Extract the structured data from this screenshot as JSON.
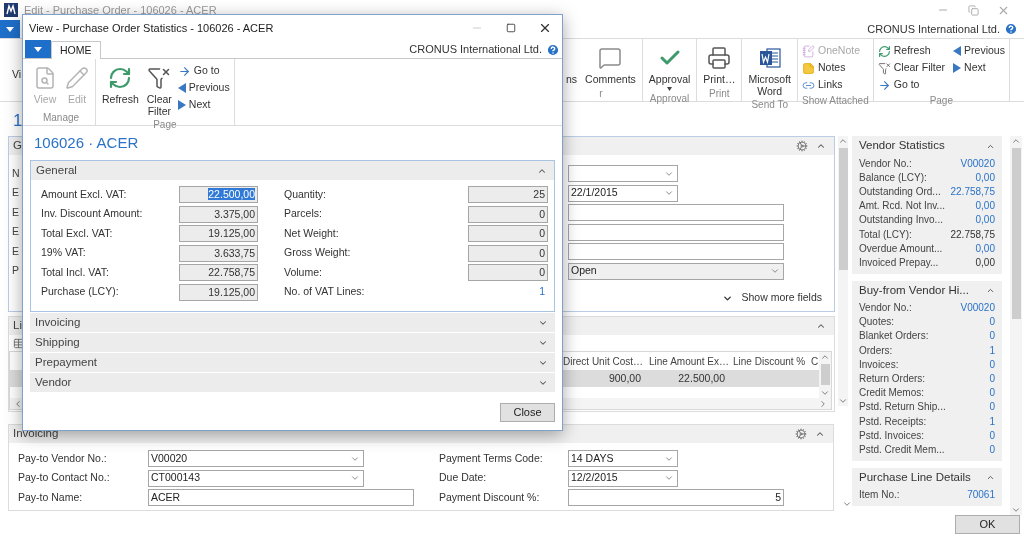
{
  "main_window": {
    "title": "Edit - Purchase Order - 106026 - ACER",
    "company": "CRONUS International Ltd.",
    "ribbon_fragment": "Vi",
    "ribbon_groups": [
      {
        "label": "r",
        "buttons": [
          {
            "kind": "large",
            "label": "ns",
            "disabled": false
          },
          {
            "kind": "large",
            "label": "Comments",
            "disabled": false
          }
        ]
      },
      {
        "label": "Approval",
        "buttons": [
          {
            "kind": "large",
            "label": "Approval",
            "dropdown": true,
            "disabled": false
          }
        ]
      },
      {
        "label": "Print",
        "buttons": [
          {
            "kind": "large",
            "label": "Print…",
            "disabled": false
          }
        ]
      },
      {
        "label": "Send To",
        "buttons": [
          {
            "kind": "large",
            "label": "Microsoft Word",
            "disabled": false
          }
        ]
      },
      {
        "label": "Show Attached",
        "buttons": [
          {
            "kind": "small",
            "label": "OneNote",
            "disabled": true
          },
          {
            "kind": "small",
            "label": "Notes",
            "disabled": false
          },
          {
            "kind": "small",
            "label": "Links",
            "disabled": false
          }
        ]
      },
      {
        "label": "Page",
        "buttons": [
          {
            "kind": "small",
            "label": "Refresh",
            "disabled": false
          },
          {
            "kind": "small",
            "label": "Clear Filter",
            "disabled": false
          },
          {
            "kind": "small",
            "label": "Go to",
            "disabled": false
          },
          {
            "kind": "small",
            "label": "Previous",
            "disabled": false
          },
          {
            "kind": "small",
            "label": "Next",
            "disabled": false
          }
        ]
      }
    ],
    "heading_fragment": "1",
    "general": {
      "title_fragment": "G",
      "expanded": true,
      "label_fragments": [
        "N",
        "E",
        "E",
        "E",
        "E",
        "P"
      ],
      "fields": [
        {
          "kind": "short-dropdown"
        },
        {
          "kind": "short-dropdown",
          "value": "22/1/2015"
        },
        {
          "kind": "text"
        },
        {
          "kind": "text"
        },
        {
          "kind": "text"
        },
        {
          "kind": "wide-dropdown",
          "value": "Open"
        }
      ],
      "show_more": "Show more fields"
    },
    "lines": {
      "title_fragment": "Li",
      "expanded": true,
      "columns": [
        "Direct Unit Cost…",
        "Line Amount Ex…",
        "Line Discount %",
        "C"
      ],
      "rows": [
        {
          "selected": true,
          "cells": [
            "900,00",
            "22.500,00"
          ]
        }
      ]
    },
    "invoicing": {
      "title": "Invoicing",
      "expanded": true,
      "left_fields": [
        {
          "label": "Pay-to Vendor No.:",
          "kind": "short-dropdown-wide",
          "value": "V00020"
        },
        {
          "label": "Pay-to Contact No.:",
          "kind": "short-dropdown-wide",
          "value": "CT000143"
        },
        {
          "label": "Pay-to Name:",
          "kind": "long-text",
          "value": "ACER"
        }
      ],
      "right_fields": [
        {
          "label": "Payment Terms Code:",
          "kind": "short-dropdown",
          "value": "14 DAYS"
        },
        {
          "label": "Due Date:",
          "kind": "short-dropdown",
          "value": "12/2/2015"
        },
        {
          "label": "Payment Discount %:",
          "kind": "number",
          "value": "5"
        }
      ]
    },
    "factboxes": [
      {
        "title": "Vendor Statistics",
        "expanded": true,
        "rows": [
          {
            "label": "Vendor No.:",
            "value": "V00020",
            "link": true
          },
          {
            "label": "Balance (LCY):",
            "value": "0,00",
            "link": true
          },
          {
            "label": "Outstanding Ord...",
            "value": "22.758,75",
            "link": true
          },
          {
            "label": "Amt. Rcd. Not Inv...",
            "value": "0,00",
            "link": true
          },
          {
            "label": "Outstanding Invo...",
            "value": "0,00",
            "link": true
          },
          {
            "label": "Total (LCY):",
            "value": "22.758,75",
            "link": false
          },
          {
            "label": "Overdue Amount...",
            "value": "0,00",
            "link": true
          },
          {
            "label": "Invoiced Prepay...",
            "value": "0,00",
            "link": false
          }
        ]
      },
      {
        "title": "Buy-from Vendor Hi...",
        "expanded": true,
        "rows": [
          {
            "label": "Vendor No.:",
            "value": "V00020",
            "link": true
          },
          {
            "label": "Quotes:",
            "value": "0",
            "link": true
          },
          {
            "label": "Blanket Orders:",
            "value": "0",
            "link": true
          },
          {
            "label": "Orders:",
            "value": "1",
            "link": true
          },
          {
            "label": "Invoices:",
            "value": "0",
            "link": true
          },
          {
            "label": "Return Orders:",
            "value": "0",
            "link": true
          },
          {
            "label": "Credit Memos:",
            "value": "0",
            "link": true
          },
          {
            "label": "Pstd. Return Ship...",
            "value": "0",
            "link": true
          },
          {
            "label": "Pstd. Receipts:",
            "value": "1",
            "link": true
          },
          {
            "label": "Pstd. Invoices:",
            "value": "0",
            "link": true
          },
          {
            "label": "Pstd. Credit Mem...",
            "value": "0",
            "link": true
          }
        ]
      },
      {
        "title": "Purchase Line Details",
        "expanded": true,
        "rows": [
          {
            "label": "Item No.:",
            "value": "70061",
            "link": true
          }
        ]
      }
    ],
    "ok_button": "OK"
  },
  "dialog": {
    "title": "View - Purchase Order Statistics - 106026 - ACER",
    "tabs": [
      {
        "label": "HOME",
        "selected": true
      }
    ],
    "company": "CRONUS International Ltd.",
    "ribbon_groups": [
      {
        "label": "Manage",
        "buttons": [
          {
            "kind": "large",
            "label": "View",
            "disabled": true
          },
          {
            "kind": "large",
            "label": "Edit",
            "disabled": true
          }
        ]
      },
      {
        "label": "Page",
        "buttons": [
          {
            "kind": "large",
            "label": "Refresh",
            "disabled": false
          },
          {
            "kind": "large",
            "label": "Clear Filter",
            "disabled": false
          },
          {
            "kind": "small",
            "label": "Go to",
            "disabled": false
          },
          {
            "kind": "small",
            "label": "Previous",
            "disabled": false
          },
          {
            "kind": "small",
            "label": "Next",
            "disabled": false
          }
        ]
      }
    ],
    "heading": "106026 · ACER",
    "sections": [
      {
        "title": "General",
        "expanded": true,
        "left_fields": [
          {
            "label": "Amount Excl. VAT:",
            "value": "22.500,00",
            "highlighted": true
          },
          {
            "label": "Inv. Discount Amount:",
            "value": "3.375,00",
            "highlighted": false
          },
          {
            "label": "Total Excl. VAT:",
            "value": "19.125,00",
            "highlighted": false
          },
          {
            "label": "19% VAT:",
            "value": "3.633,75",
            "highlighted": false
          },
          {
            "label": "Total Incl. VAT:",
            "value": "22.758,75",
            "highlighted": false
          },
          {
            "label": "Purchase (LCY):",
            "value": "19.125,00",
            "highlighted": false
          }
        ],
        "right_fields": [
          {
            "label": "Quantity:",
            "value": "25",
            "kind": "box"
          },
          {
            "label": "Parcels:",
            "value": "0",
            "kind": "box"
          },
          {
            "label": "Net Weight:",
            "value": "0",
            "kind": "box"
          },
          {
            "label": "Gross Weight:",
            "value": "0",
            "kind": "box"
          },
          {
            "label": "Volume:",
            "value": "0",
            "kind": "box"
          },
          {
            "label": "No. of VAT Lines:",
            "value": "1",
            "kind": "link"
          }
        ]
      },
      {
        "title": "Invoicing",
        "expanded": false
      },
      {
        "title": "Shipping",
        "expanded": false
      },
      {
        "title": "Prepayment",
        "expanded": false
      },
      {
        "title": "Vendor",
        "expanded": false
      }
    ],
    "close_button": "Close"
  }
}
